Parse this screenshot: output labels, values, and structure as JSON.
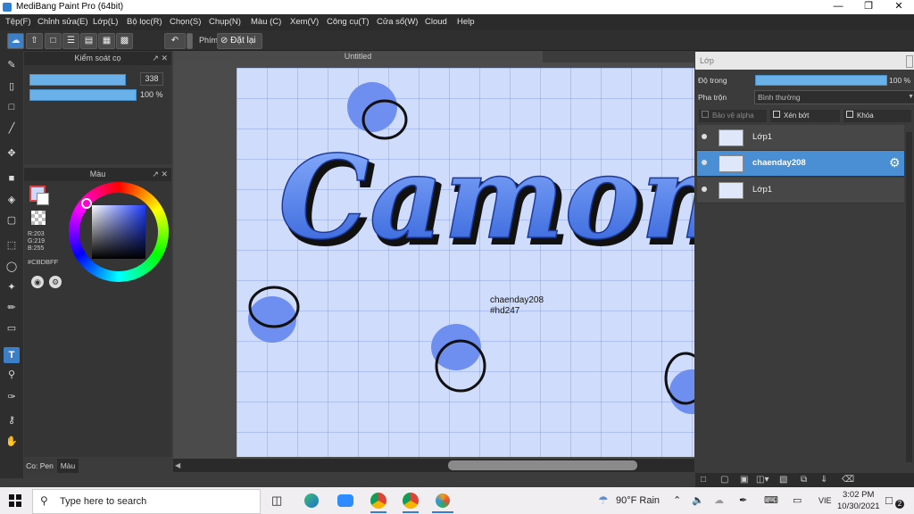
{
  "window": {
    "title": "MediBang Paint Pro (64bit)"
  },
  "menu": [
    "Tệp(F)",
    "Chỉnh sửa(E)",
    "Lớp(L)",
    "Bộ lọc(R)",
    "Chọn(S)",
    "Chụp(N)",
    "Màu (C)",
    "Xem(V)",
    "Công cụ(T)",
    "Cửa sổ(W)",
    "Cloud",
    "Help"
  ],
  "toolbar": {
    "key_label": "Phím",
    "reset_label": "Đặt lại"
  },
  "brush_panel": {
    "title": "Kiểm soát cọ",
    "size_value": "338",
    "opacity_value": "100 %",
    "size_fraction": 0.9,
    "opacity_fraction": 1.0
  },
  "color_panel": {
    "title": "Màu",
    "r": "R:203",
    "g": "G:219",
    "b": "B:255",
    "hex": "#CBDBFF",
    "current_color": "#cbdbff"
  },
  "left_tabs": {
    "tab1": "Co: Pen",
    "tab2": "Màu"
  },
  "canvas": {
    "tab_title": "Untitled",
    "lettering": "Camon",
    "credit_line1": "chaenday208",
    "credit_line2": "#hd247"
  },
  "layers_panel": {
    "title": "Lớp",
    "opacity_label": "Độ trong",
    "opacity_value": "100 %",
    "opacity_fraction": 1.0,
    "blend_label": "Pha trộn",
    "blend_value": "Bình thường",
    "protect_alpha": "Bảo vệ alpha",
    "clipping": "Xén bớt",
    "lock": "Khóa",
    "layers": [
      {
        "name": "Lớp1",
        "selected": false
      },
      {
        "name": "chaenday208",
        "selected": true
      },
      {
        "name": "Lớp1",
        "selected": false
      }
    ]
  },
  "taskbar": {
    "search_placeholder": "Type here to search",
    "weather": "90°F  Rain",
    "lang": "VIE",
    "time": "3:02 PM",
    "date": "10/30/2021",
    "notifications": "2"
  },
  "colors": {
    "accent": "#3d7fc6",
    "canvas_bg": "#cfdcfb",
    "blob": "#6f8ff0"
  }
}
